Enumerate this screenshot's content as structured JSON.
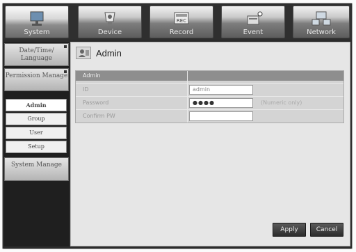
{
  "tabs": [
    {
      "label": "System",
      "icon": "monitor-icon"
    },
    {
      "label": "Device",
      "icon": "camera-icon"
    },
    {
      "label": "Record",
      "icon": "rec-icon"
    },
    {
      "label": "Event",
      "icon": "event-icon"
    },
    {
      "label": "Network",
      "icon": "network-icon"
    }
  ],
  "sidebar": {
    "major": [
      {
        "label": "Date/Time/ Language"
      },
      {
        "label": "Permission Manage"
      },
      {
        "label": "System Manage"
      }
    ],
    "sub": [
      {
        "label": "Admin"
      },
      {
        "label": "Group"
      },
      {
        "label": "User"
      },
      {
        "label": "Setup"
      }
    ]
  },
  "page": {
    "title": "Admin"
  },
  "admin": {
    "header": "Admin",
    "rows": [
      {
        "label": "ID",
        "value": "admin",
        "note": ""
      },
      {
        "label": "Password",
        "value": "●●●●",
        "note": "(Numeric only)"
      },
      {
        "label": "Confirm PW",
        "value": "",
        "note": ""
      }
    ]
  },
  "buttons": {
    "apply": "Apply",
    "cancel": "Cancel"
  },
  "colors": {
    "frame": "#2b2b2b",
    "panel": "#e6e6e6",
    "header": "#8e8e8e",
    "button": "#3a3a3a"
  }
}
